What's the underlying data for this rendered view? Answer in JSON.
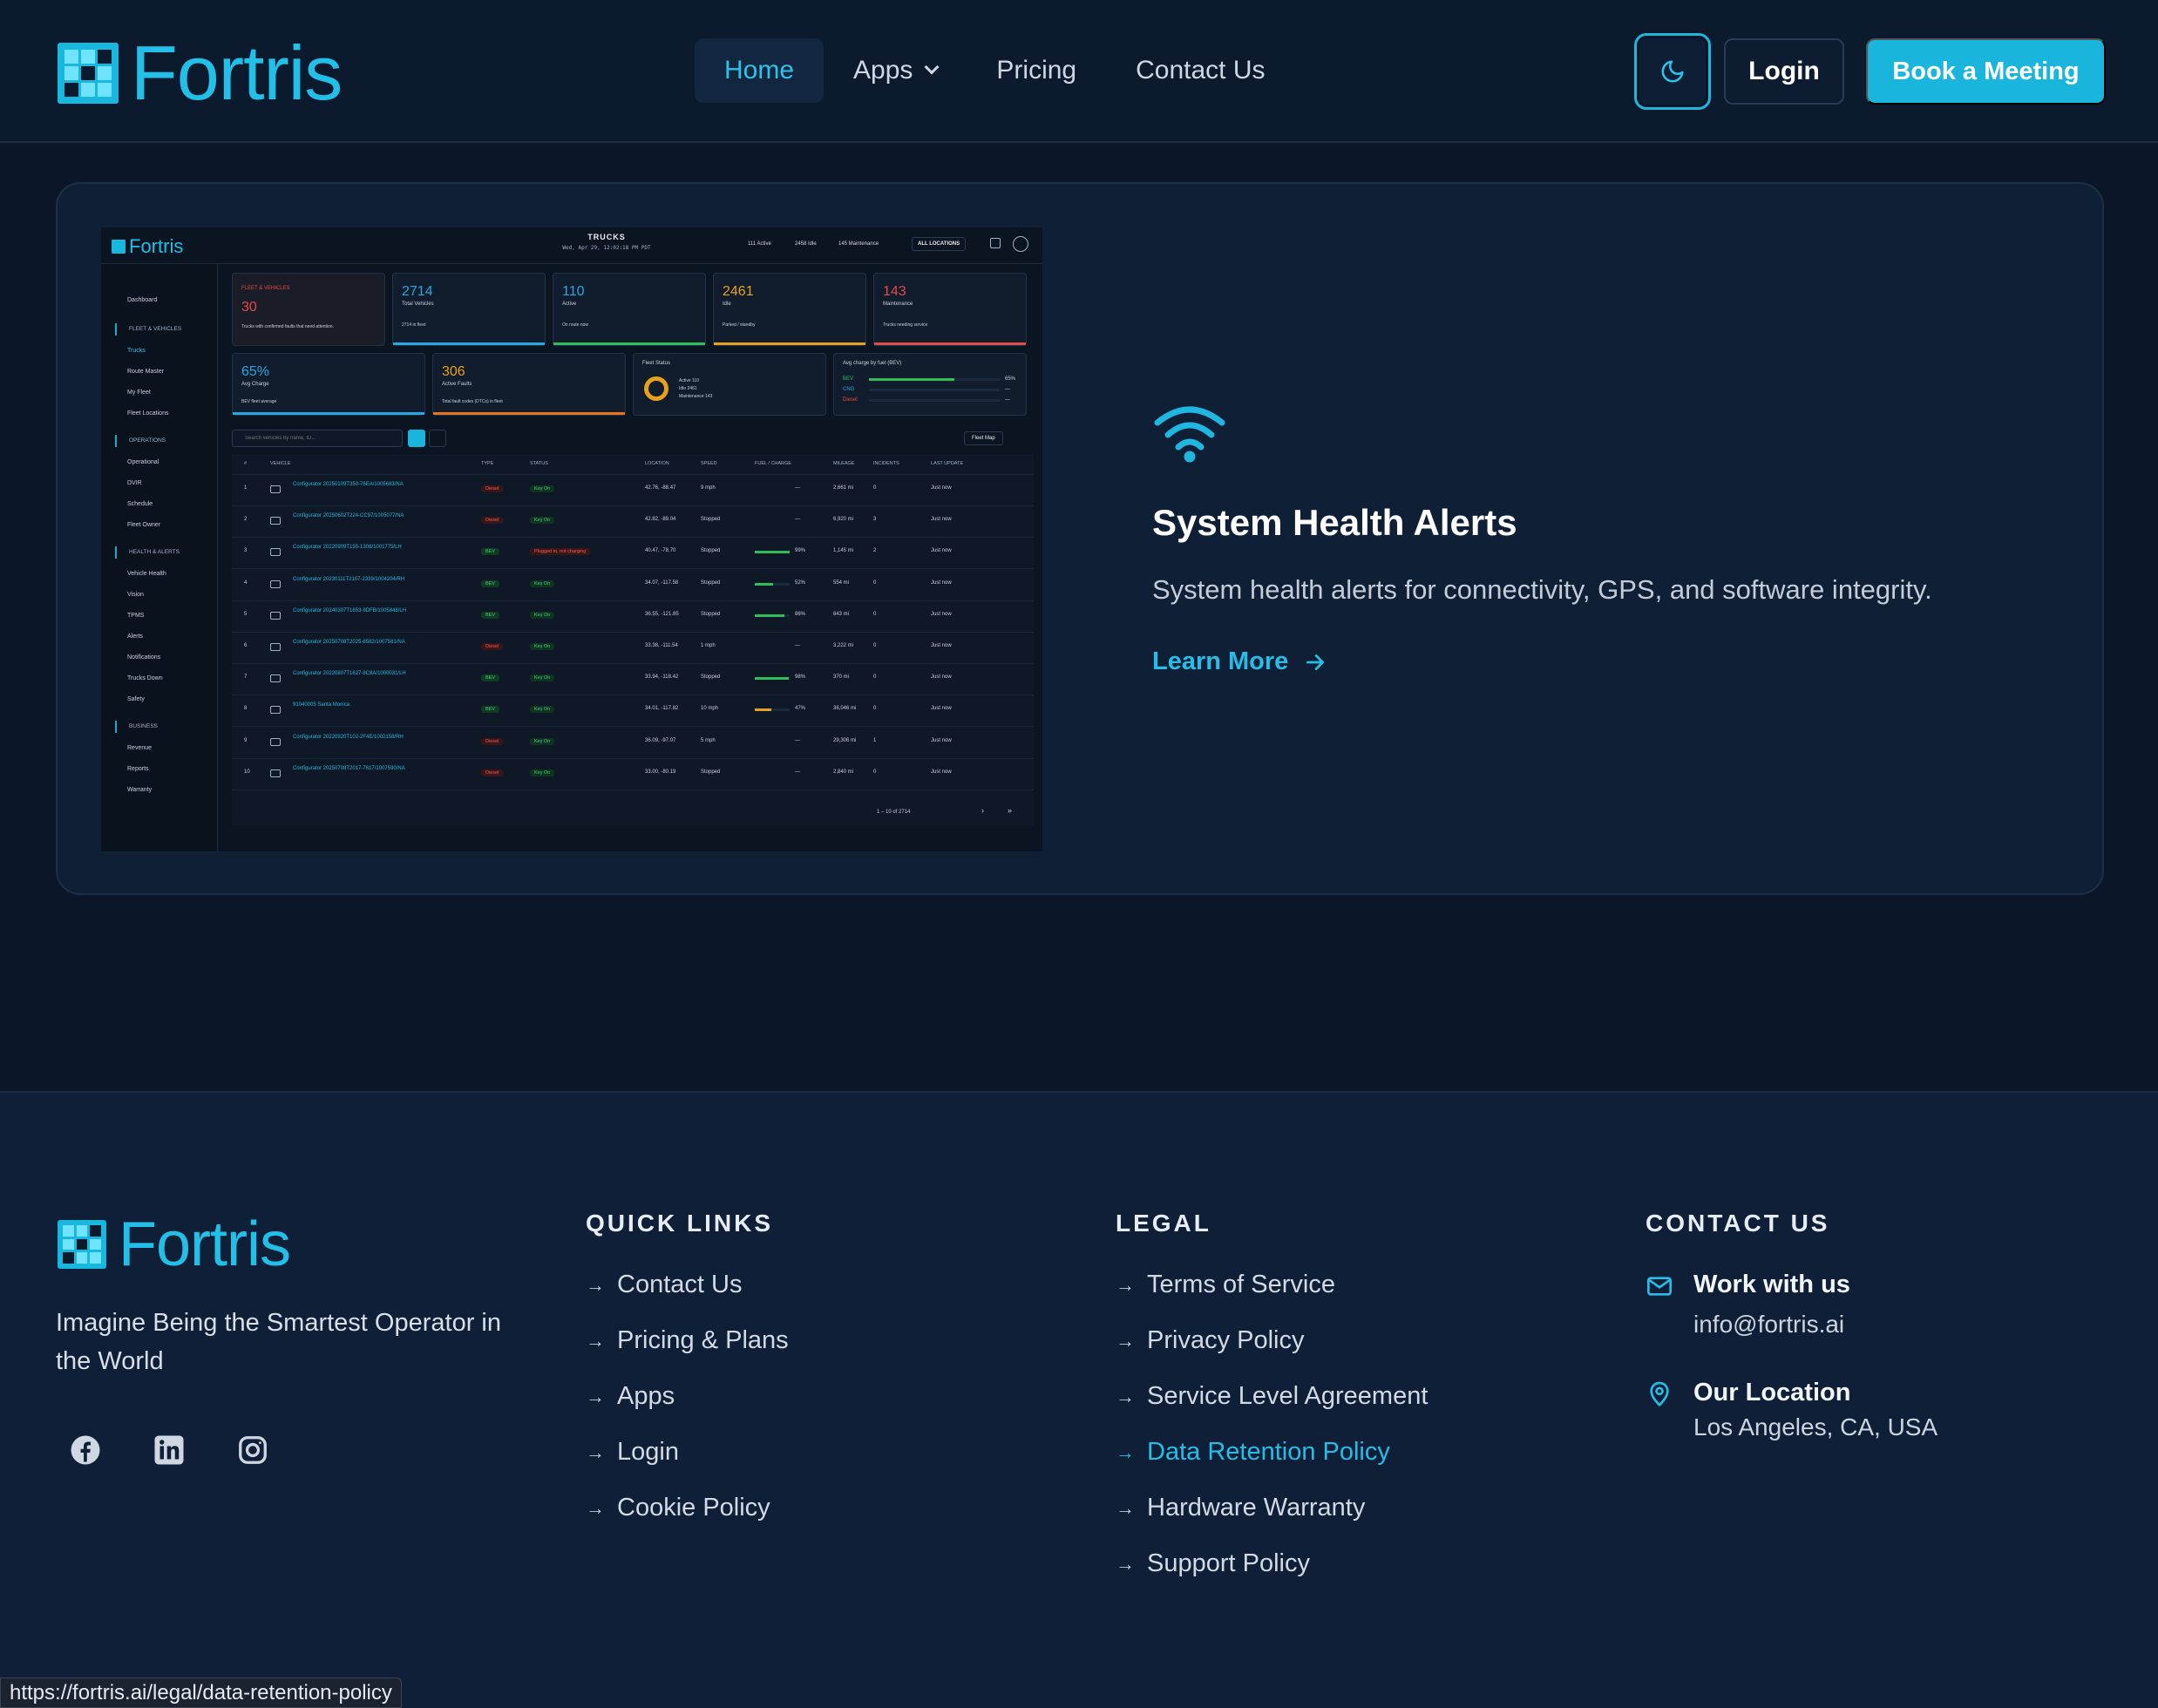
{
  "brand": {
    "name": "Fortris"
  },
  "nav": {
    "links": [
      {
        "label": "Home",
        "active": true
      },
      {
        "label": "Apps",
        "active": false,
        "dropdown": true
      },
      {
        "label": "Pricing",
        "active": false
      },
      {
        "label": "Contact Us",
        "active": false
      }
    ],
    "theme_icon": "moon-icon",
    "login_label": "Login",
    "cta_label": "Book a Meeting"
  },
  "feature": {
    "icon": "wifi-icon",
    "title": "System Health Alerts",
    "description": "System health alerts for connectivity, GPS, and software integrity.",
    "link_label": "Learn More"
  },
  "screenshot": {
    "brand": "Fortris",
    "title": "TRUCKS",
    "date": "Wed, Apr 29, 12:02:18 PM PDT",
    "status": [
      "111 Active",
      "2458 Idle",
      "145 Maintenance"
    ],
    "location_filter": "ALL LOCATIONS",
    "sidebar": {
      "dashboard": "Dashboard",
      "sections": [
        {
          "label": "FLEET & VEHICLES",
          "items": [
            "Trucks",
            "Route Master",
            "My Fleet",
            "Fleet Locations"
          ]
        },
        {
          "label": "OPERATIONS",
          "items": [
            "Operational",
            "DVIR",
            "Schedule",
            "Fleet Owner"
          ]
        },
        {
          "label": "HEALTH & ALERTS",
          "items": [
            "Vehicle Health",
            "Vision",
            "TPMS",
            "Alerts",
            "Notifications",
            "Trucks Down",
            "Safety"
          ]
        },
        {
          "label": "BUSINESS",
          "items": [
            "Revenue",
            "Reports",
            "Warranty"
          ]
        }
      ]
    },
    "kpis": [
      {
        "value": "30",
        "label": "FLEET & VEHICLES",
        "sub": "Trucks with confirmed faults that need attention.",
        "color": "#e24a4a"
      },
      {
        "value": "2714",
        "label": "Total Vehicles",
        "sub": "2714 in fleet",
        "color": "#2aa6e0"
      },
      {
        "value": "110",
        "label": "Active",
        "sub": "On route now",
        "color": "#2fbf5a"
      },
      {
        "value": "2461",
        "label": "Idle",
        "sub": "Parked / standby",
        "color": "#e6a21e"
      },
      {
        "value": "143",
        "label": "Maintenance",
        "sub": "Trucks needing service",
        "color": "#e24a4a"
      },
      {
        "value": "65%",
        "label": "Avg Charge",
        "sub": "BEV fleet average",
        "color": "#2aa6e0"
      },
      {
        "value": "306",
        "label": "Active Faults",
        "sub": "Total fault codes (DTCs) in fleet",
        "color": "#e6751e"
      }
    ],
    "fleet_status": {
      "title": "Fleet Status",
      "items": [
        "Active 110",
        "Idle 2461",
        "Maintenance 143"
      ]
    },
    "avg_charge": {
      "title": "Avg charge by fuel (BEV)",
      "rows": [
        {
          "k": "BEV",
          "v": "65%"
        },
        {
          "k": "CNG",
          "v": "—"
        },
        {
          "k": "Diesel",
          "v": "—"
        }
      ]
    },
    "search_placeholder": "Search vehicles by name, ID...",
    "fleet_map": "Fleet Map",
    "columns": [
      "#",
      "VEHICLE",
      "TYPE",
      "STATUS",
      "LOCATION",
      "SPEED",
      "FUEL / CHARGE",
      "MILEAGE",
      "INCIDENTS",
      "LAST UPDATE"
    ],
    "rows": [
      {
        "n": "1",
        "v": "Configurator 20250109T350-76EA/1005683/NA",
        "t": "Diesel",
        "s": "Key On",
        "loc": "42.76, -88.47",
        "sp": "9 mph",
        "f": "—",
        "m": "2,661 mi",
        "i": "0",
        "u": "Just now"
      },
      {
        "n": "2",
        "v": "Configurator 20250602T224-CC97/1005077/NA",
        "t": "Diesel",
        "s": "Key On",
        "loc": "42.82, -89.04",
        "sp": "Stopped",
        "f": "—",
        "m": "6,920 mi",
        "i": "3",
        "u": "Just now"
      },
      {
        "n": "3",
        "v": "Configurator 20220909T155-1308/1001775/LH",
        "t": "BEV",
        "s": "Plugged in, not charging",
        "loc": "40.47, -78.70",
        "sp": "Stopped",
        "f": "99%",
        "m": "1,145 mi",
        "i": "2",
        "u": "Just now"
      },
      {
        "n": "4",
        "v": "Configurator 20230111T2107-2339/1004204/RH",
        "t": "BEV",
        "s": "Key On",
        "loc": "34.07, -117.58",
        "sp": "Stopped",
        "f": "52%",
        "m": "554 mi",
        "i": "0",
        "u": "Just now"
      },
      {
        "n": "5",
        "v": "Configurator 20240307T1653-9DFB/1005848/LH",
        "t": "BEV",
        "s": "Key On",
        "loc": "36.55, -121.85",
        "sp": "Stopped",
        "f": "86%",
        "m": "643 mi",
        "i": "0",
        "u": "Just now"
      },
      {
        "n": "6",
        "v": "Configurator 20250708T2025-6582/1007581/NA",
        "t": "Diesel",
        "s": "Key On",
        "loc": "33.38, -111.54",
        "sp": "1 mph",
        "f": "—",
        "m": "3,222 mi",
        "i": "0",
        "u": "Just now"
      },
      {
        "n": "7",
        "v": "Configurator 20220807T1627-8C8A/1000031/LH",
        "t": "BEV",
        "s": "Key On",
        "loc": "33.94, -118.42",
        "sp": "Stopped",
        "f": "98%",
        "m": "370 mi",
        "i": "0",
        "u": "Just now"
      },
      {
        "n": "8",
        "v": "91040005 Santa Monica",
        "t": "BEV",
        "s": "Key On",
        "loc": "34.01, -117.82",
        "sp": "10 mph",
        "f": "47%",
        "m": "36,046 mi",
        "i": "0",
        "u": "Just now"
      },
      {
        "n": "9",
        "v": "Configurator 20220920T102-2F4E/1002158/RH",
        "t": "Diesel",
        "s": "Key On",
        "loc": "36.09, -97.07",
        "sp": "5 mph",
        "f": "—",
        "m": "29,306 mi",
        "i": "1",
        "u": "Just now"
      },
      {
        "n": "10",
        "v": "Configurator 20250708T2017-7617/1007590/NA",
        "t": "Diesel",
        "s": "Key On",
        "loc": "33.00, -80.19",
        "sp": "Stopped",
        "f": "—",
        "m": "2,840 mi",
        "i": "0",
        "u": "Just now"
      }
    ],
    "pagination": "1 – 10 of 2714"
  },
  "footer": {
    "brand": "Fortris",
    "tagline": "Imagine Being the Smartest Operator in the World",
    "socials": [
      "facebook-icon",
      "linkedin-icon",
      "instagram-icon"
    ],
    "quick_links": {
      "title": "QUICK LINKS",
      "items": [
        "Contact Us",
        "Pricing & Plans",
        "Apps",
        "Login",
        "Cookie Policy"
      ]
    },
    "legal": {
      "title": "LEGAL",
      "items": [
        "Terms of Service",
        "Privacy Policy",
        "Service Level Agreement",
        "Data Retention Policy",
        "Hardware Warranty",
        "Support Policy"
      ],
      "hover_index": 3
    },
    "contact": {
      "title": "CONTACT US",
      "work_label": "Work with us",
      "email": "info@fortris.ai",
      "location_label": "Our Location",
      "location": "Los Angeles, CA, USA"
    }
  },
  "status_url": "https://fortris.ai/legal/data-retention-policy",
  "colors": {
    "accent": "#19b5dc",
    "bg": "#0b1729",
    "card": "#0f1f36",
    "footer": "#0f1f38"
  }
}
